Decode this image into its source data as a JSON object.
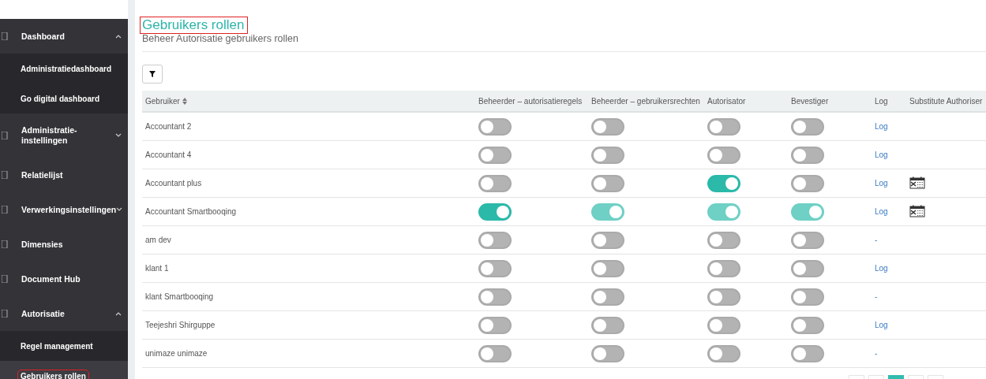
{
  "sidebar": {
    "items": [
      {
        "label": "Dashboard",
        "expanded": true,
        "children": [
          {
            "label": "Administratiedashboard",
            "selected": false
          },
          {
            "label": "Go digital dashboard",
            "selected": false
          }
        ]
      },
      {
        "label": "Administratie-instellingen",
        "expanded": false
      },
      {
        "label": "Relatielijst"
      },
      {
        "label": "Verwerkingsinstellingen",
        "expanded": false
      },
      {
        "label": "Dimensies"
      },
      {
        "label": "Document Hub"
      },
      {
        "label": "Autorisatie",
        "expanded": true,
        "children": [
          {
            "label": "Regel management",
            "selected": false
          },
          {
            "label": "Gebruikers rollen",
            "selected": true
          }
        ]
      }
    ]
  },
  "header": {
    "title": "Gebruikers rollen",
    "subtitle": "Beheer Autorisatie gebruikers rollen"
  },
  "table": {
    "columns": [
      "Gebruiker",
      "Beheerder – autorisatieregels",
      "Beheerder – gebruikersrechten",
      "Autorisator",
      "Bevestiger",
      "Log",
      "Substitute Authoriser"
    ],
    "rows": [
      {
        "user": "Accountant 2",
        "roles": [
          {
            "on": false,
            "disabled": false
          },
          {
            "on": false,
            "disabled": false
          },
          {
            "on": false,
            "disabled": false
          },
          {
            "on": false,
            "disabled": false
          }
        ],
        "log": "Log",
        "substitute": false
      },
      {
        "user": "Accountant 4",
        "roles": [
          {
            "on": false,
            "disabled": false
          },
          {
            "on": false,
            "disabled": false
          },
          {
            "on": false,
            "disabled": false
          },
          {
            "on": false,
            "disabled": false
          }
        ],
        "log": "Log",
        "substitute": false
      },
      {
        "user": "Accountant plus",
        "roles": [
          {
            "on": false,
            "disabled": false
          },
          {
            "on": false,
            "disabled": false
          },
          {
            "on": true,
            "disabled": false
          },
          {
            "on": false,
            "disabled": false
          }
        ],
        "log": "Log",
        "substitute": true
      },
      {
        "user": "Accountant Smartbooqing",
        "roles": [
          {
            "on": true,
            "disabled": false
          },
          {
            "on": true,
            "disabled": true
          },
          {
            "on": true,
            "disabled": true
          },
          {
            "on": true,
            "disabled": true
          }
        ],
        "log": "Log",
        "substitute": true
      },
      {
        "user": "am dev",
        "roles": [
          {
            "on": false,
            "disabled": false
          },
          {
            "on": false,
            "disabled": false
          },
          {
            "on": false,
            "disabled": false
          },
          {
            "on": false,
            "disabled": false
          }
        ],
        "log": "-",
        "substitute": false
      },
      {
        "user": "klant 1",
        "roles": [
          {
            "on": false,
            "disabled": false
          },
          {
            "on": false,
            "disabled": false
          },
          {
            "on": false,
            "disabled": false
          },
          {
            "on": false,
            "disabled": false
          }
        ],
        "log": "Log",
        "substitute": false
      },
      {
        "user": "klant Smartbooqing",
        "roles": [
          {
            "on": false,
            "disabled": false
          },
          {
            "on": false,
            "disabled": false
          },
          {
            "on": false,
            "disabled": false
          },
          {
            "on": false,
            "disabled": false
          }
        ],
        "log": "-",
        "substitute": false
      },
      {
        "user": "Teejeshri Shirguppe",
        "roles": [
          {
            "on": false,
            "disabled": false
          },
          {
            "on": false,
            "disabled": false
          },
          {
            "on": false,
            "disabled": false
          },
          {
            "on": false,
            "disabled": false
          }
        ],
        "log": "Log",
        "substitute": false
      },
      {
        "user": "unimaze unimaze",
        "roles": [
          {
            "on": false,
            "disabled": false
          },
          {
            "on": false,
            "disabled": false
          },
          {
            "on": false,
            "disabled": false
          },
          {
            "on": false,
            "disabled": false
          }
        ],
        "log": "-",
        "substitute": false
      }
    ]
  },
  "pagination": [
    {
      "selected": false
    },
    {
      "selected": false
    },
    {
      "selected": true
    },
    {
      "selected": false
    },
    {
      "selected": false
    }
  ]
}
